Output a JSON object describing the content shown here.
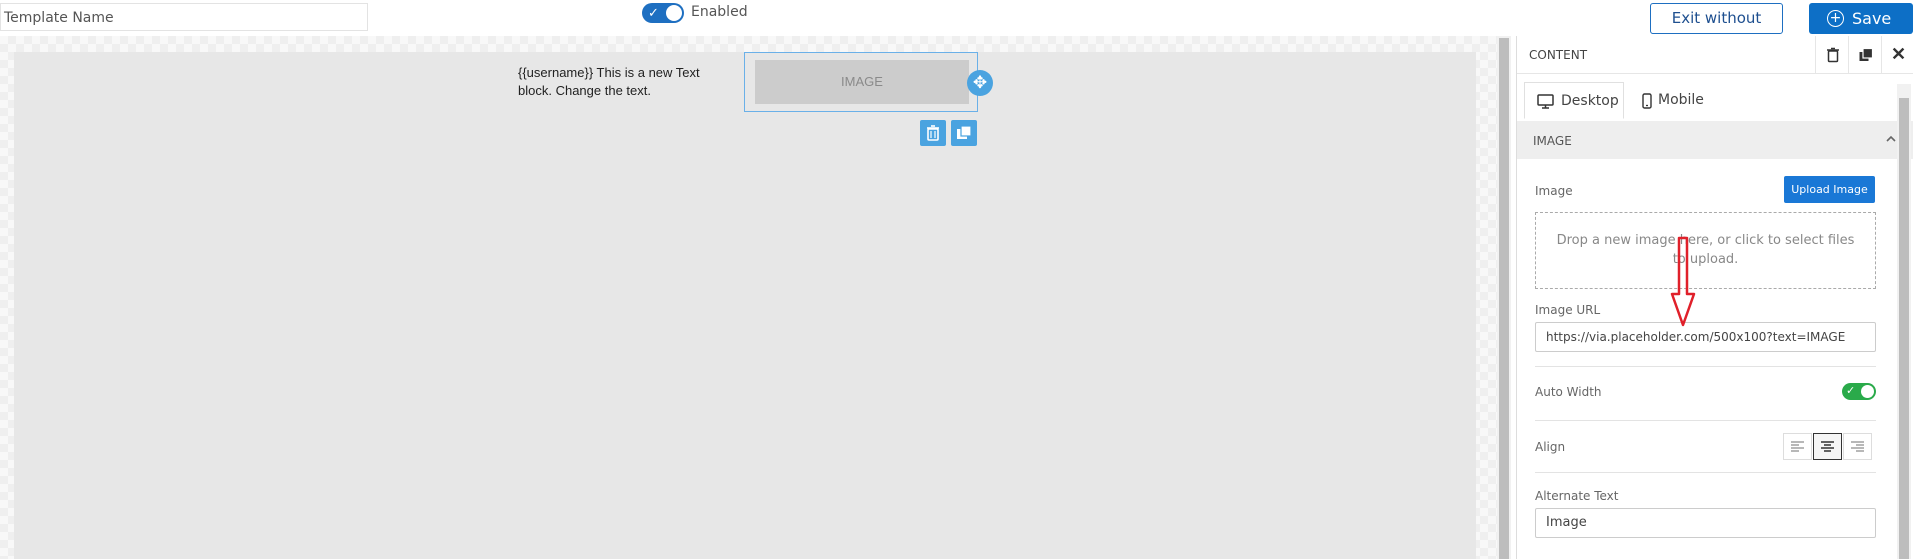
{
  "topbar": {
    "template_name_placeholder": "Template Name",
    "enabled_label": "Enabled",
    "exit_label": "Exit without Save",
    "save_label": "Save"
  },
  "canvas": {
    "text_block": "{{username}} This is a new Text block. Change the text.",
    "image_placeholder": "IMAGE"
  },
  "panel": {
    "title": "CONTENT",
    "tabs": [
      {
        "label": "Desktop",
        "icon": "desktop-icon",
        "active": true
      },
      {
        "label": "Mobile",
        "icon": "mobile-icon",
        "active": false
      }
    ],
    "section_title": "IMAGE",
    "image_label": "Image",
    "upload_button": "Upload Image",
    "dropzone_text": "Drop a new image here, or click to select files to upload.",
    "image_url_label": "Image URL",
    "image_url_value": "https://via.placeholder.com/500x100?text=IMAGE",
    "auto_width_label": "Auto Width",
    "auto_width_enabled": true,
    "align_label": "Align",
    "align_selected": "center",
    "alt_text_label": "Alternate Text",
    "alt_text_value": "Image"
  },
  "colors": {
    "primary": "#0d6fc6",
    "toggle_on": "#2aaa4a",
    "accent_handle": "#4aa3e0",
    "annotation": "#e0202a"
  }
}
